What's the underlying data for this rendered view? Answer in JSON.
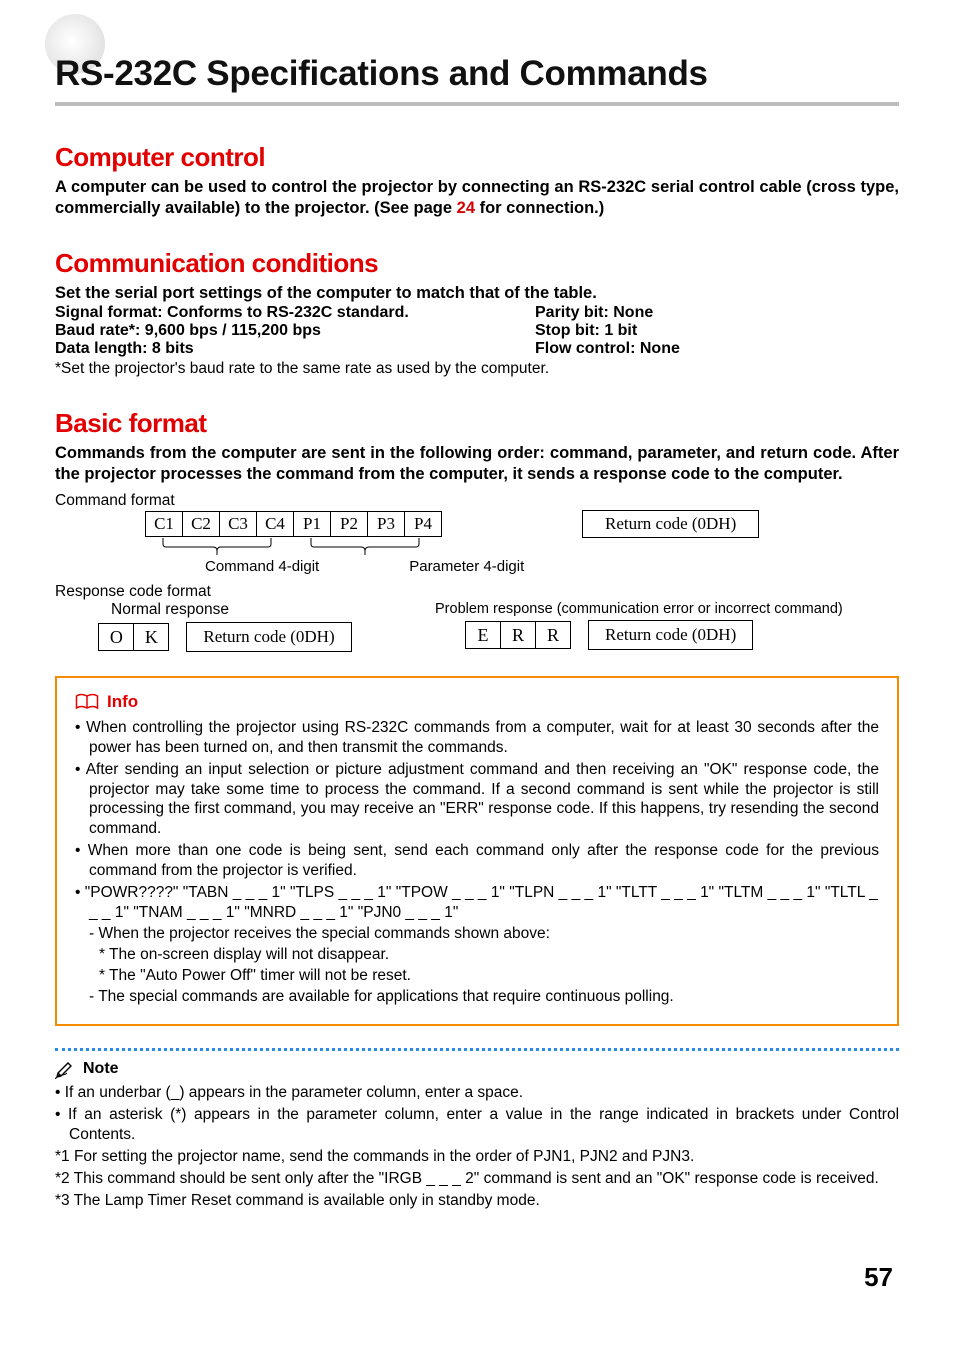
{
  "title": "RS-232C Specifications and Commands",
  "sections": {
    "computer_control": {
      "heading": "Computer control",
      "text_a": "A computer can be used to control the projector by connecting an RS-232C serial control cable (cross type, commercially available) to the projector. (See page ",
      "page_ref": "24",
      "text_b": " for connection.)"
    },
    "comm": {
      "heading": "Communication conditions",
      "intro": "Set the serial port settings of the computer to match that of the table.",
      "l1a": "Signal format: Conforms to RS-232C standard.",
      "l1b": "Parity bit: None",
      "l2a": "Baud rate*: 9,600 bps / 115,200 bps",
      "l2b": "Stop bit: 1 bit",
      "l3a": "Data length: 8 bits",
      "l3b": "Flow control: None",
      "footnote": "*Set the projector's baud rate to the same rate as used by the computer."
    },
    "basic": {
      "heading": "Basic format",
      "text": "Commands from the computer are sent in the following order: command, parameter, and return code. After the projector processes the command from the computer, it sends a response code to the computer."
    },
    "diagram": {
      "cmd_format_label": "Command format",
      "cells": {
        "c1": "C1",
        "c2": "C2",
        "c3": "C3",
        "c4": "C4",
        "p1": "P1",
        "p2": "P2",
        "p3": "P3",
        "p4": "P4"
      },
      "return_code": "Return code (0DH)",
      "under1": "Command 4-digit",
      "under2": "Parameter 4-digit",
      "resp_format_label": "Response code format",
      "normal_label": "Normal response",
      "problem_label": "Problem response (communication error or incorrect command)",
      "ok": {
        "o": "O",
        "k": "K"
      },
      "err": {
        "e": "E",
        "r1": "R",
        "r2": "R"
      }
    }
  },
  "info": {
    "label": "Info",
    "items": [
      "When controlling the projector using RS-232C commands from a computer, wait for at least 30 seconds after the power has been turned on, and then transmit the commands.",
      "After sending an input selection or picture adjustment command and then receiving an \"OK\" response code, the projector may take some time to process the command. If a second command is sent while the projector is still processing the first command, you may receive an \"ERR\" response code. If this happens, try resending the second command.",
      "When more than one code is being sent, send each command only after the response code for the previous command from the projector is verified.",
      "\"POWR????\" \"TABN _ _ _ 1\" \"TLPS _ _ _ 1\" \"TPOW _ _ _ 1\" \"TLPN _ _ _ 1\" \"TLTT _ _ _ 1\" \"TLTM _ _ _ 1\" \"TLTL _ _ _ 1\" \"TNAM _ _ _ 1\" \"MNRD _ _ _ 1\" \"PJN0 _ _ _ 1\""
    ],
    "subitems": [
      "- When the projector receives the special commands shown above:",
      "* The on-screen display will not disappear.",
      "* The \"Auto Power Off\" timer will not be reset.",
      "- The special commands are available for applications that require continuous polling."
    ]
  },
  "note": {
    "label": "Note",
    "items": [
      "If an underbar (_) appears in the parameter column, enter a space.",
      "If an asterisk (*) appears in the parameter column, enter a value in the range indicated in brackets under Control Contents."
    ],
    "stars": [
      "*1 For setting the projector name, send the commands in the order of PJN1, PJN2 and PJN3.",
      "*2 This command should be sent only after the \"IRGB _ _ _ 2\" command is sent and an \"OK\" response code is received.",
      "*3 The Lamp Timer Reset command is available only in standby mode."
    ]
  },
  "page_number": "57"
}
